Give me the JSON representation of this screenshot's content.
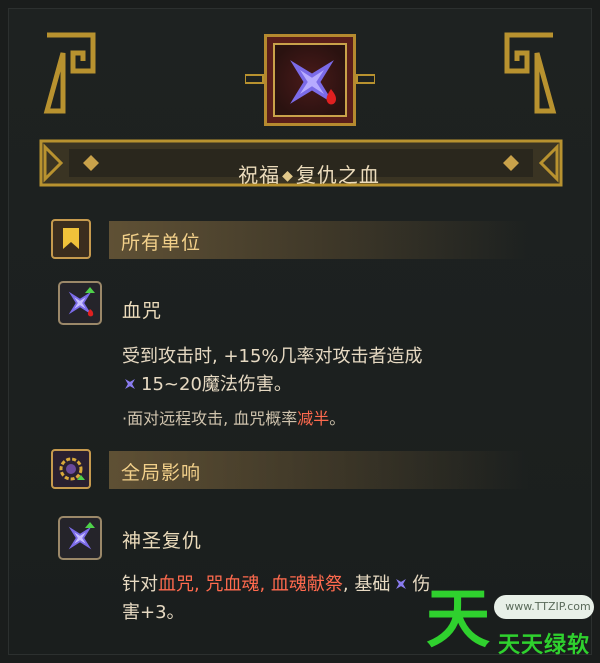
{
  "title": {
    "left": "祝福",
    "separator": "◆",
    "right": "复仇之血"
  },
  "sections": [
    {
      "header": "所有单位",
      "header_icon": "banner-icon",
      "ability": {
        "name": "血咒",
        "icon": "shuriken-blood-icon",
        "desc_1": "受到攻击时, +15%几率对攻击者造成",
        "desc_2": "15~20魔法伤害。",
        "note_prefix": "·面对远程攻击, 血咒概率",
        "note_highlight": "减半",
        "note_suffix": "。"
      }
    },
    {
      "header": "全局影响",
      "header_icon": "ring-aura-icon",
      "ability": {
        "name": "神圣复仇",
        "icon": "shuriken-holy-icon",
        "line1_prefix": "针对",
        "line1_red": "血咒, 咒血魂, 血魂献祭",
        "line1_suffix": ", 基础",
        "line1_end": "伤",
        "line2": "害+3。"
      }
    }
  ],
  "watermark": {
    "char": "天",
    "url": "www.TTZIP.com",
    "name": "天天绿软"
  },
  "colors": {
    "gold": "#c9a24a",
    "accent_red": "#ff6a4e",
    "header_text": "#f2d08a",
    "body_text": "#e6d9c2",
    "watermark_green": "#2fd12e"
  }
}
